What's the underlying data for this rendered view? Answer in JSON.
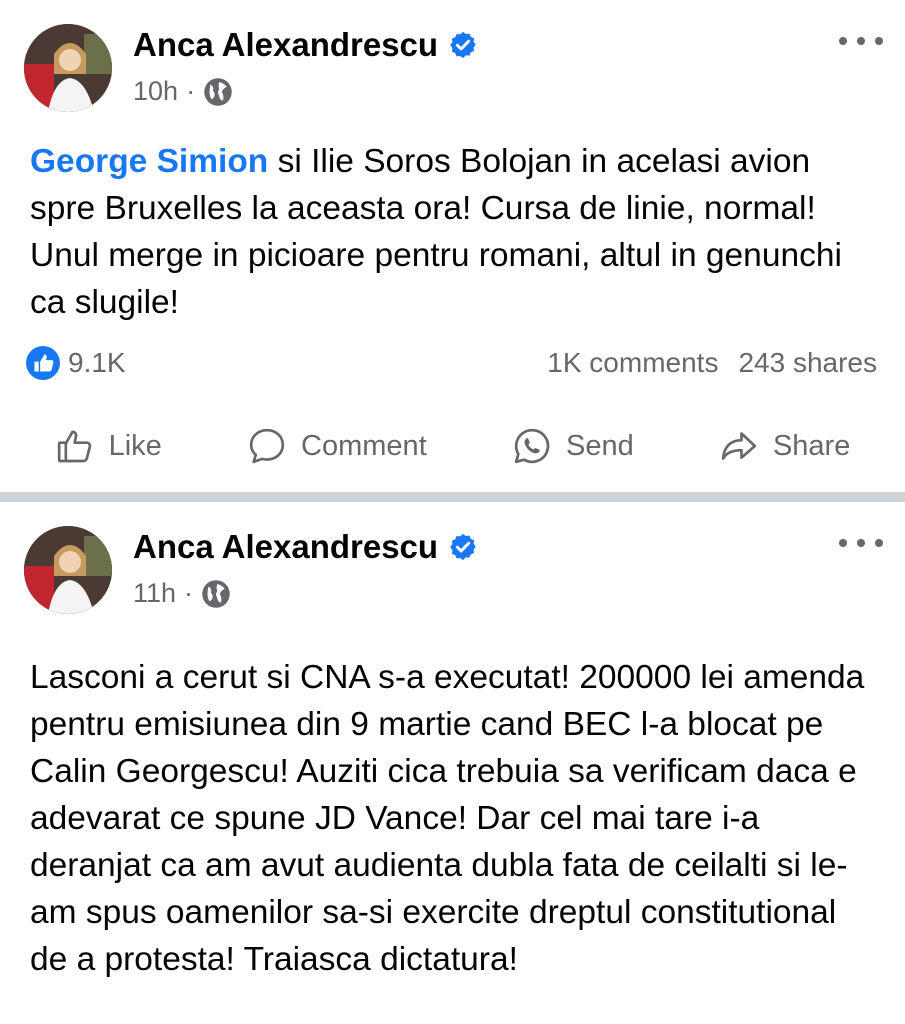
{
  "colors": {
    "link": "#1877f2",
    "secondary_text": "#65676b",
    "divider": "#cfd2d6"
  },
  "posts": [
    {
      "author": "Anca Alexandrescu",
      "time": "10h",
      "separator": "·",
      "audience_icon": "globe-icon",
      "mention": "George Simion",
      "text": " si Ilie Soros Bolojan in acelasi avion spre Bruxelles la aceasta ora! Cursa de linie, normal! Unul merge in picioare pentru romani, altul in genunchi ca slugile!",
      "reactions_count": "9.1K",
      "comments": "1K comments",
      "shares": "243 shares",
      "actions": {
        "like": "Like",
        "comment": "Comment",
        "send": "Send",
        "share": "Share"
      }
    },
    {
      "author": "Anca Alexandrescu",
      "time": "11h",
      "separator": "·",
      "audience_icon": "globe-icon",
      "text": "Lasconi a cerut si CNA s-a executat! 200000 lei amenda pentru emisiunea din 9 martie cand BEC l-a blocat pe Calin Georgescu! Auziti cica trebuia sa verificam daca e adevarat ce spune JD Vance! Dar cel mai tare i-a deranjat ca am avut audienta dubla fata de ceilalti si le-am spus oamenilor sa-si exercite dreptul constitutional de a protesta! Traiasca dictatura!"
    }
  ]
}
